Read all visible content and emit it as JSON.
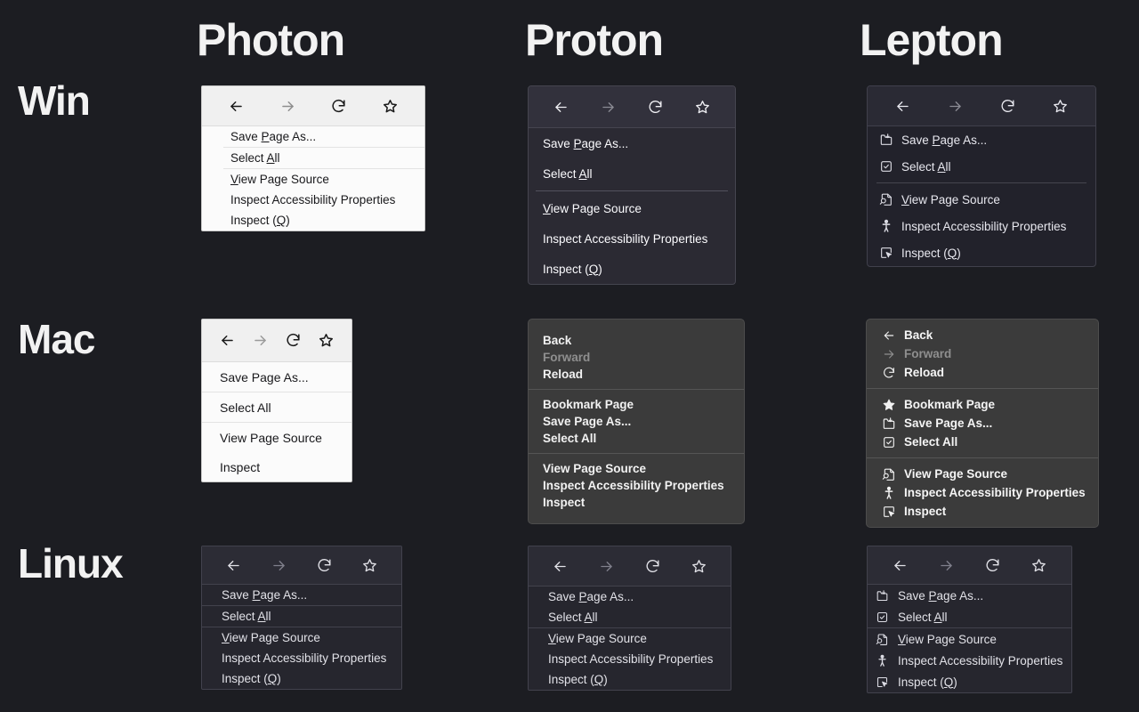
{
  "page": {
    "background_color": "#1c1d22",
    "columns": [
      {
        "id": "photon",
        "label": "Photon"
      },
      {
        "id": "proton",
        "label": "Proton"
      },
      {
        "id": "lepton",
        "label": "Lepton"
      }
    ],
    "rows": [
      {
        "id": "win",
        "label": "Win"
      },
      {
        "id": "mac",
        "label": "Mac"
      },
      {
        "id": "linux",
        "label": "Linux"
      }
    ]
  },
  "toolbar_buttons": [
    {
      "name": "back-icon",
      "label": "Back",
      "state": "enabled"
    },
    {
      "name": "forward-icon",
      "label": "Forward",
      "state": "disabled"
    },
    {
      "name": "reload-icon",
      "label": "Reload",
      "state": "enabled"
    },
    {
      "name": "bookmark-icon",
      "label": "Bookmark",
      "state": "enabled"
    }
  ],
  "menus": {
    "photon_win": {
      "theme": "light",
      "has_toolbar": true,
      "has_icons": false,
      "accelerators": true,
      "items": [
        {
          "type": "item",
          "label": "Save Page As...",
          "accel": "P",
          "icon": "save-page-icon"
        },
        {
          "type": "separator"
        },
        {
          "type": "item",
          "label": "Select All",
          "accel": "A",
          "icon": "select-all-icon"
        },
        {
          "type": "separator"
        },
        {
          "type": "item",
          "label": "View Page Source",
          "accel": "V",
          "icon": "view-source-icon"
        },
        {
          "type": "item",
          "label": "Inspect Accessibility Properties",
          "icon": "accessibility-icon"
        },
        {
          "type": "item",
          "label": "Inspect (Q)",
          "accel": "Q",
          "icon": "inspect-icon"
        }
      ]
    },
    "proton_win": {
      "theme": "dark",
      "has_toolbar": true,
      "has_icons": false,
      "accelerators": true,
      "items": [
        {
          "type": "item",
          "label": "Save Page As...",
          "accel": "P"
        },
        {
          "type": "item",
          "label": "Select All",
          "accel": "A"
        },
        {
          "type": "separator"
        },
        {
          "type": "item",
          "label": "View Page Source",
          "accel": "V"
        },
        {
          "type": "item",
          "label": "Inspect Accessibility Properties"
        },
        {
          "type": "item",
          "label": "Inspect (Q)",
          "accel": "Q"
        }
      ]
    },
    "lepton_win": {
      "theme": "dark",
      "has_toolbar": true,
      "has_icons": true,
      "accelerators": true,
      "items": [
        {
          "type": "item",
          "label": "Save Page As...",
          "accel": "P",
          "icon": "save-page-icon"
        },
        {
          "type": "item",
          "label": "Select All",
          "accel": "A",
          "icon": "select-all-icon"
        },
        {
          "type": "separator"
        },
        {
          "type": "item",
          "label": "View Page Source",
          "accel": "V",
          "icon": "view-source-icon"
        },
        {
          "type": "item",
          "label": "Inspect Accessibility Properties",
          "icon": "accessibility-icon"
        },
        {
          "type": "item",
          "label": "Inspect (Q)",
          "accel": "Q",
          "icon": "inspect-icon"
        }
      ]
    },
    "photon_mac": {
      "theme": "light",
      "has_toolbar": true,
      "has_icons": false,
      "accelerators": false,
      "items": [
        {
          "type": "item",
          "label": "Save Page As..."
        },
        {
          "type": "separator"
        },
        {
          "type": "item",
          "label": "Select All"
        },
        {
          "type": "separator"
        },
        {
          "type": "item",
          "label": "View Page Source"
        },
        {
          "type": "item",
          "label": "Inspect"
        }
      ]
    },
    "proton_mac": {
      "theme": "dark",
      "has_toolbar": false,
      "has_icons": false,
      "accelerators": false,
      "items": [
        {
          "type": "item",
          "label": "Back"
        },
        {
          "type": "item",
          "label": "Forward",
          "state": "disabled"
        },
        {
          "type": "item",
          "label": "Reload"
        },
        {
          "type": "separator"
        },
        {
          "type": "item",
          "label": "Bookmark Page"
        },
        {
          "type": "item",
          "label": "Save Page As..."
        },
        {
          "type": "item",
          "label": "Select All"
        },
        {
          "type": "separator"
        },
        {
          "type": "item",
          "label": "View Page Source"
        },
        {
          "type": "item",
          "label": "Inspect Accessibility Properties"
        },
        {
          "type": "item",
          "label": "Inspect"
        }
      ]
    },
    "lepton_mac": {
      "theme": "dark",
      "has_toolbar": false,
      "has_icons": true,
      "accelerators": false,
      "items": [
        {
          "type": "item",
          "label": "Back",
          "icon": "back-icon"
        },
        {
          "type": "item",
          "label": "Forward",
          "icon": "forward-icon",
          "state": "disabled"
        },
        {
          "type": "item",
          "label": "Reload",
          "icon": "reload-icon"
        },
        {
          "type": "separator"
        },
        {
          "type": "item",
          "label": "Bookmark Page",
          "icon": "star-filled-icon"
        },
        {
          "type": "item",
          "label": "Save Page As...",
          "icon": "save-page-icon"
        },
        {
          "type": "item",
          "label": "Select All",
          "icon": "select-all-icon"
        },
        {
          "type": "separator"
        },
        {
          "type": "item",
          "label": "View Page Source",
          "icon": "view-source-icon"
        },
        {
          "type": "item",
          "label": "Inspect Accessibility Properties",
          "icon": "accessibility-icon"
        },
        {
          "type": "item",
          "label": "Inspect",
          "icon": "inspect-icon"
        }
      ]
    },
    "photon_linux": {
      "theme": "dark",
      "has_toolbar": true,
      "has_icons": false,
      "accelerators": true,
      "items": [
        {
          "type": "item",
          "label": "Save Page As...",
          "accel": "P"
        },
        {
          "type": "separator"
        },
        {
          "type": "item",
          "label": "Select All",
          "accel": "A"
        },
        {
          "type": "separator"
        },
        {
          "type": "item",
          "label": "View Page Source",
          "accel": "V"
        },
        {
          "type": "item",
          "label": "Inspect Accessibility Properties"
        },
        {
          "type": "item",
          "label": "Inspect (Q)",
          "accel": "Q"
        }
      ]
    },
    "proton_linux": {
      "theme": "dark",
      "has_toolbar": true,
      "has_icons": false,
      "accelerators": true,
      "items": [
        {
          "type": "item",
          "label": "Save Page As...",
          "accel": "P"
        },
        {
          "type": "item",
          "label": "Select All",
          "accel": "A"
        },
        {
          "type": "separator"
        },
        {
          "type": "item",
          "label": "View Page Source",
          "accel": "V"
        },
        {
          "type": "item",
          "label": "Inspect Accessibility Properties"
        },
        {
          "type": "item",
          "label": "Inspect (Q)",
          "accel": "Q"
        }
      ]
    },
    "lepton_linux": {
      "theme": "dark",
      "has_toolbar": true,
      "has_icons": true,
      "accelerators": true,
      "items": [
        {
          "type": "item",
          "label": "Save Page As...",
          "accel": "P",
          "icon": "save-page-icon"
        },
        {
          "type": "item",
          "label": "Select All",
          "accel": "A",
          "icon": "select-all-icon"
        },
        {
          "type": "separator"
        },
        {
          "type": "item",
          "label": "View Page Source",
          "accel": "V",
          "icon": "view-source-icon"
        },
        {
          "type": "item",
          "label": "Inspect Accessibility Properties",
          "icon": "accessibility-icon"
        },
        {
          "type": "item",
          "label": "Inspect (Q)",
          "accel": "Q",
          "icon": "inspect-icon"
        }
      ]
    }
  }
}
